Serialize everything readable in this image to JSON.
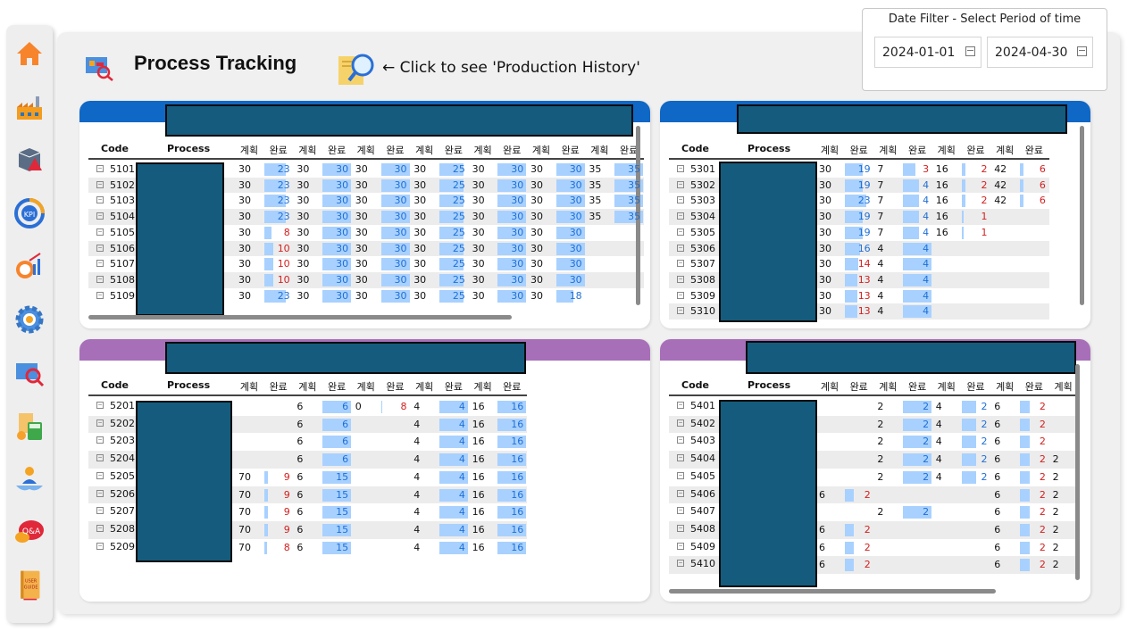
{
  "app": {
    "title": "Process Tracking",
    "history_link": "← Click to see 'Production History'"
  },
  "date_filter": {
    "label": "Date Filter - Select Period of time",
    "start": "2024-01-01",
    "end": "2024-04-30"
  },
  "sidebar": {
    "items": [
      {
        "name": "home-icon"
      },
      {
        "name": "factory-icon"
      },
      {
        "name": "box-alert-icon"
      },
      {
        "name": "kpi-icon"
      },
      {
        "name": "clock-chart-icon"
      },
      {
        "name": "gear-icon"
      },
      {
        "name": "process-search-icon"
      },
      {
        "name": "cost-calculator-icon"
      },
      {
        "name": "people-icon"
      },
      {
        "name": "qna-icon"
      },
      {
        "name": "user-guide-icon",
        "text": "USER GUIDE"
      }
    ]
  },
  "colors": {
    "blue_bar": "#0f67c6",
    "purple_bar": "#a86fb9",
    "redact": "#155b7d",
    "done_text": "#1f6fd6",
    "red_text": "#d42020"
  },
  "tables": [
    {
      "id": "panel-1",
      "headers": {
        "code": "Code",
        "process": "Process",
        "plan": "계획",
        "done": "완료"
      },
      "cols": 14,
      "rows": [
        {
          "code": "5101",
          "cells": [
            "30",
            "23",
            "30",
            "30",
            "30",
            "30",
            "30",
            "25",
            "30",
            "30",
            "30",
            "30",
            "35",
            "35"
          ]
        },
        {
          "code": "5102",
          "cells": [
            "30",
            "23",
            "30",
            "30",
            "30",
            "30",
            "30",
            "25",
            "30",
            "30",
            "30",
            "30",
            "35",
            "35"
          ]
        },
        {
          "code": "5103",
          "cells": [
            "30",
            "23",
            "30",
            "30",
            "30",
            "30",
            "30",
            "25",
            "30",
            "30",
            "30",
            "30",
            "35",
            "35"
          ]
        },
        {
          "code": "5104",
          "cells": [
            "30",
            "23",
            "30",
            "30",
            "30",
            "30",
            "30",
            "25",
            "30",
            "30",
            "30",
            "30",
            "35",
            "35"
          ]
        },
        {
          "code": "5105",
          "cells": [
            "30",
            "8",
            "30",
            "30",
            "30",
            "30",
            "30",
            "25",
            "30",
            "30",
            "30",
            "30",
            "",
            ""
          ]
        },
        {
          "code": "5106",
          "cells": [
            "30",
            "10",
            "30",
            "30",
            "30",
            "30",
            "30",
            "25",
            "30",
            "30",
            "30",
            "30",
            "",
            ""
          ]
        },
        {
          "code": "5107",
          "cells": [
            "30",
            "10",
            "30",
            "30",
            "30",
            "30",
            "30",
            "25",
            "30",
            "30",
            "30",
            "30",
            "",
            ""
          ]
        },
        {
          "code": "5108",
          "cells": [
            "30",
            "10",
            "30",
            "30",
            "30",
            "30",
            "30",
            "25",
            "30",
            "30",
            "30",
            "30",
            "",
            ""
          ]
        },
        {
          "code": "5109",
          "cells": [
            "30",
            "23",
            "30",
            "30",
            "30",
            "30",
            "30",
            "25",
            "30",
            "30",
            "30",
            "18",
            "",
            ""
          ]
        }
      ]
    },
    {
      "id": "panel-2",
      "headers": {
        "code": "Code",
        "process": "Process",
        "plan": "계획",
        "done": "완료"
      },
      "cols": 8,
      "rows": [
        {
          "code": "5301",
          "cells": [
            "30",
            "19",
            "7",
            "3",
            "16",
            "2",
            "42",
            "6"
          ]
        },
        {
          "code": "5302",
          "cells": [
            "30",
            "19",
            "7",
            "4",
            "16",
            "2",
            "42",
            "6"
          ]
        },
        {
          "code": "5303",
          "cells": [
            "30",
            "23",
            "7",
            "4",
            "16",
            "2",
            "42",
            "6"
          ]
        },
        {
          "code": "5304",
          "cells": [
            "30",
            "19",
            "7",
            "4",
            "16",
            "1",
            "",
            ""
          ]
        },
        {
          "code": "5305",
          "cells": [
            "30",
            "19",
            "7",
            "4",
            "16",
            "1",
            "",
            ""
          ]
        },
        {
          "code": "5306",
          "cells": [
            "30",
            "16",
            "4",
            "4",
            "",
            "",
            "",
            ""
          ]
        },
        {
          "code": "5307",
          "cells": [
            "30",
            "14",
            "4",
            "4",
            "",
            "",
            "",
            ""
          ]
        },
        {
          "code": "5308",
          "cells": [
            "30",
            "13",
            "4",
            "4",
            "",
            "",
            "",
            ""
          ]
        },
        {
          "code": "5309",
          "cells": [
            "30",
            "13",
            "4",
            "4",
            "",
            "",
            "",
            ""
          ]
        },
        {
          "code": "5310",
          "cells": [
            "30",
            "13",
            "4",
            "4",
            "",
            "",
            "",
            ""
          ]
        }
      ]
    },
    {
      "id": "panel-3",
      "headers": {
        "code": "Code",
        "process": "Process",
        "plan": "계획",
        "done": "완료"
      },
      "cols": 10,
      "rows": [
        {
          "code": "5201",
          "cells": [
            "",
            "",
            "6",
            "6",
            "0",
            "8",
            "4",
            "4",
            "16",
            "16"
          ]
        },
        {
          "code": "5202",
          "cells": [
            "",
            "",
            "6",
            "6",
            "",
            "",
            "4",
            "4",
            "16",
            "16"
          ]
        },
        {
          "code": "5203",
          "cells": [
            "",
            "",
            "6",
            "6",
            "",
            "",
            "4",
            "4",
            "16",
            "16"
          ]
        },
        {
          "code": "5204",
          "cells": [
            "",
            "",
            "6",
            "6",
            "",
            "",
            "4",
            "4",
            "16",
            "16"
          ]
        },
        {
          "code": "5205",
          "cells": [
            "70",
            "9",
            "6",
            "15",
            "",
            "",
            "4",
            "4",
            "16",
            "16"
          ]
        },
        {
          "code": "5206",
          "cells": [
            "70",
            "9",
            "6",
            "15",
            "",
            "",
            "4",
            "4",
            "16",
            "16"
          ]
        },
        {
          "code": "5207",
          "cells": [
            "70",
            "9",
            "6",
            "15",
            "",
            "",
            "4",
            "4",
            "16",
            "16"
          ]
        },
        {
          "code": "5208",
          "cells": [
            "70",
            "9",
            "6",
            "15",
            "",
            "",
            "4",
            "4",
            "16",
            "16"
          ]
        },
        {
          "code": "5209",
          "cells": [
            "70",
            "8",
            "6",
            "15",
            "",
            "",
            "4",
            "4",
            "16",
            "16"
          ]
        }
      ]
    },
    {
      "id": "panel-4",
      "headers": {
        "code": "Code",
        "process": "Process",
        "plan": "계획",
        "done": "완료"
      },
      "cols": 9,
      "rows": [
        {
          "code": "5401",
          "cells": [
            "",
            "",
            "2",
            "2",
            "4",
            "2",
            "6",
            "2",
            ""
          ]
        },
        {
          "code": "5402",
          "cells": [
            "",
            "",
            "2",
            "2",
            "4",
            "2",
            "6",
            "2",
            ""
          ]
        },
        {
          "code": "5403",
          "cells": [
            "",
            "",
            "2",
            "2",
            "4",
            "2",
            "6",
            "2",
            ""
          ]
        },
        {
          "code": "5404",
          "cells": [
            "",
            "",
            "2",
            "2",
            "4",
            "2",
            "6",
            "2",
            "2"
          ]
        },
        {
          "code": "5405",
          "cells": [
            "",
            "",
            "2",
            "2",
            "4",
            "2",
            "6",
            "2",
            "2"
          ]
        },
        {
          "code": "5406",
          "cells": [
            "6",
            "2",
            "",
            "",
            "",
            "",
            "6",
            "2",
            "2"
          ]
        },
        {
          "code": "5407",
          "cells": [
            "",
            "",
            "2",
            "2",
            "",
            "",
            "6",
            "2",
            "2"
          ]
        },
        {
          "code": "5408",
          "cells": [
            "6",
            "2",
            "",
            "",
            "",
            "",
            "6",
            "2",
            "2"
          ]
        },
        {
          "code": "5409",
          "cells": [
            "6",
            "2",
            "",
            "",
            "",
            "",
            "6",
            "2",
            "2"
          ]
        },
        {
          "code": "5410",
          "cells": [
            "6",
            "2",
            "",
            "",
            "",
            "",
            "6",
            "2",
            "2"
          ]
        }
      ]
    }
  ]
}
